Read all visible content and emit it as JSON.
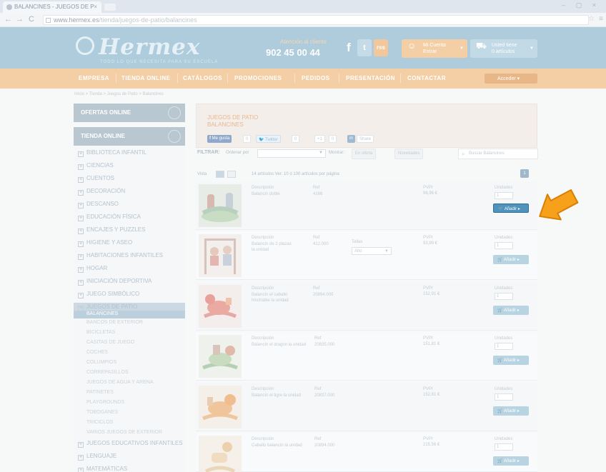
{
  "browser": {
    "tab_title": "BALANCINES - JUEGOS DE P",
    "tab_close": "×",
    "url_domain": "www.hermex.es",
    "url_path": "/tienda/juegos-de-patio/balancines",
    "back_icon": "←",
    "forward_icon": "→",
    "reload_icon": "C",
    "star_icon": "☆",
    "menu_icon": "≡",
    "window_controls": "– ▢ ×"
  },
  "header": {
    "logo": "Hermex",
    "tagline": "TODO LO QUE NECESITA PARA SU ESCUELA",
    "phone_label": "Atención al cliente",
    "phone_number": "902 45 00 44",
    "social": [
      "f",
      "t",
      "rss"
    ],
    "account_button": {
      "line1": "Mi Cuenta",
      "line2": "Entrar"
    },
    "cart_button": {
      "line1": "Usted tiene",
      "line2": "0 artículos"
    }
  },
  "nav": {
    "items": [
      "EMPRESA",
      "TIENDA ONLINE",
      "CATÁLOGOS",
      "PROMOCIONES",
      "PEDIDOS",
      "PRESENTACIÓN",
      "CONTACTAR"
    ],
    "login": "Acceder"
  },
  "breadcrumb": "Inicio > Tienda > Juegos de Patio > Balancines",
  "sidebar": {
    "section1": "OFERTAS ONLINE",
    "section2": "TIENDA ONLINE",
    "categories": [
      "BIBLIOTECA INFANTIL",
      "CIENCIAS",
      "CUENTOS",
      "DECORACIÓN",
      "DESCANSO",
      "EDUCACIÓN FÍSICA",
      "ENCAJES Y PUZZLES",
      "HIGIENE Y ASEO",
      "HABITACIONES INFANTILES",
      "HOGAR",
      "INICIACIÓN DEPORTIVA",
      "JUEGO SIMBÓLICO",
      "JUEGOS DE PATIO"
    ],
    "active_sub": "BALANCINES",
    "subcategories": [
      "BANCOS DE EXTERIOR",
      "BICICLETAS",
      "CASITAS DE JUEGO",
      "COCHES",
      "COLUMPIOS",
      "CORREPASILLOS",
      "JUEGOS DE AGUA Y ARENA",
      "PATINETES",
      "PLAYGROUNDS",
      "TOBOGANES",
      "TRICICLOS",
      "VARIOS JUEGOS DE EXTERIOR"
    ],
    "after": [
      "JUEGOS EDUCATIVOS INFANTILES",
      "LENGUAJE",
      "MATEMÁTICAS"
    ]
  },
  "main": {
    "title_line1": "JUEGOS DE PATIO",
    "title_line2": "BALANCINES",
    "share": {
      "like": "Me gusta",
      "like_count": "0",
      "tweet": "Twitter",
      "tweet_count": "0",
      "gplus": "+1",
      "gplus_count": "0",
      "linkedin": "in",
      "share": "Share"
    },
    "filter_label": "FILTRAR:",
    "order_label": "Ordenar por",
    "order_value": "",
    "show_label": "Mostrar:",
    "pill1": "En oferta",
    "pill2": "Novedades",
    "search_placeholder": "Buscar Balancines",
    "view_label": "Vista",
    "count_text": "14 artículos  Ver: 10 ó 100 artículos por página",
    "page": "1"
  },
  "products": [
    {
      "desc_label": "Descripción",
      "desc": "Balancín doble",
      "ref_label": "Ref",
      "ref": "4166",
      "price_label": "PVPr",
      "price": "98,96 €",
      "units_label": "Unidades",
      "qty": "1",
      "add": "Añadir"
    },
    {
      "desc_label": "Descripción",
      "desc": "Balancín de 2 plazas la unidad",
      "ref_label": "Ref",
      "ref": "412.000",
      "talla_label": "Tallas",
      "talla": "Alto",
      "price_label": "PVPr",
      "price": "93,99 €",
      "units_label": "Unidades",
      "qty": "1",
      "add": "Añadir"
    },
    {
      "desc_label": "Descripción",
      "desc": "Balancín el caballo hinchable la unidad",
      "ref_label": "Ref",
      "ref": "20894.000",
      "price_label": "PVPr",
      "price": "152,91 €",
      "units_label": "Unidades",
      "qty": "1",
      "add": "Añadir"
    },
    {
      "desc_label": "Descripción",
      "desc": "Balancín el dragón la unidad",
      "ref_label": "Ref",
      "ref": "20835.000",
      "price_label": "PVPr",
      "price": "151,81 €",
      "units_label": "Unidades",
      "qty": "1",
      "add": "Añadir"
    },
    {
      "desc_label": "Descripción",
      "desc": "Balancín el tigre la unidad",
      "ref_label": "Ref",
      "ref": "20837.000",
      "price_label": "PVPr",
      "price": "152,81 €",
      "units_label": "Unidades",
      "qty": "1",
      "add": "Añadir"
    },
    {
      "desc_label": "Descripción",
      "desc": "Caballo balancín la unidad",
      "ref_label": "Ref",
      "ref": "20894.000",
      "price_label": "PVPr",
      "price": "215,56 €",
      "units_label": "Unidades",
      "qty": "1",
      "add": "Añadir"
    }
  ],
  "colors": {
    "brand_blue": "#aeccdc",
    "nav_orange": "#f4cfa6",
    "add_button_active": "#4f93bd",
    "arrow_orange": "#f7a11a"
  },
  "icons": {
    "cart": "cart-icon",
    "arrow": "pointer-arrow-icon",
    "search": "search-icon"
  }
}
